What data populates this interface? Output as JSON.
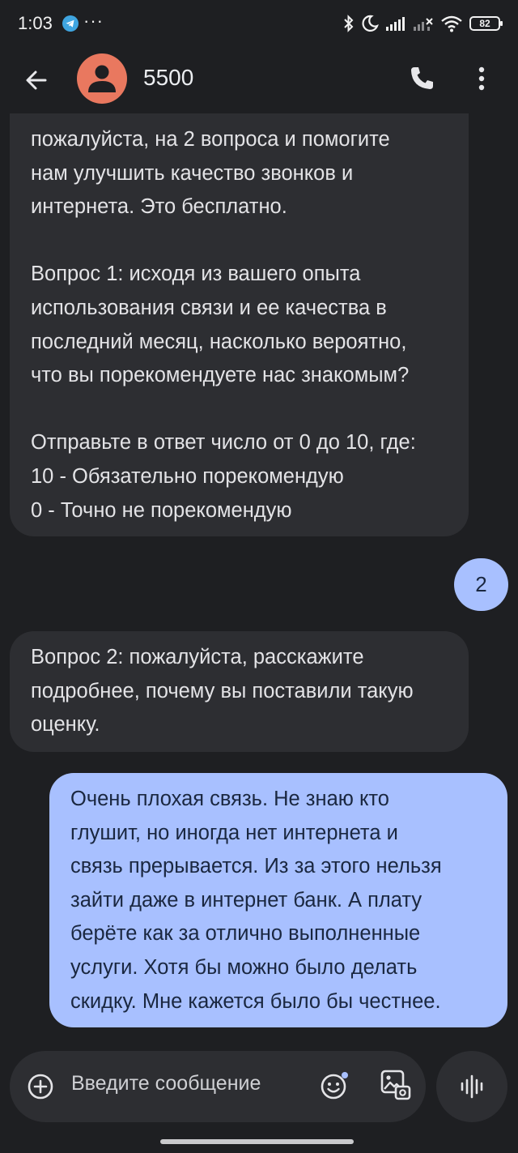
{
  "status_bar": {
    "time": "1:03",
    "notification_icons": [
      "telegram-icon",
      "more-notifications-icon"
    ],
    "system_icons": [
      "bluetooth-icon",
      "do-not-disturb-icon",
      "signal-icon",
      "signal-no-service-icon",
      "wifi-icon"
    ],
    "battery_level": "82"
  },
  "app_bar": {
    "contact_name": "5500",
    "avatar_color": "#e9785f"
  },
  "messages": [
    {
      "direction": "incoming",
      "text": "пожалуйста, на 2 вопроса и помогите\nнам улучшить качество звонков и\nинтернета. Это бесплатно.\n\nВопрос 1: исходя из вашего опыта\nиспользования связи и ее качества в\nпоследний месяц, насколько вероятно,\nчто вы порекомендуете нас знакомым?\n\nОтправьте в ответ число от 0 до 10, где:\n10 - Обязательно порекомендую\n0 - Точно не порекомендую"
    },
    {
      "direction": "outgoing",
      "text": "2"
    },
    {
      "direction": "incoming",
      "text": "Вопрос 2: пожалуйста, расскажите\nподробнее, почему вы поставили такую\nоценку."
    },
    {
      "direction": "outgoing",
      "text": "Очень плохая связь. Не знаю кто\nглушит, но иногда нет интернета и\nсвязь прерывается. Из за этого нельзя\nзайти даже в интернет банк. А плату\nберёте как за отлично выполненные\nуслуги. Хотя бы можно было делать\nскидку. Мне кажется было бы честнее."
    }
  ],
  "compose": {
    "placeholder": "Введите сообщение"
  },
  "colors": {
    "background": "#1e1f22",
    "incoming_bubble": "#2d2e32",
    "outgoing_bubble": "#a8c0ff",
    "accent": "#a8c0ff"
  }
}
